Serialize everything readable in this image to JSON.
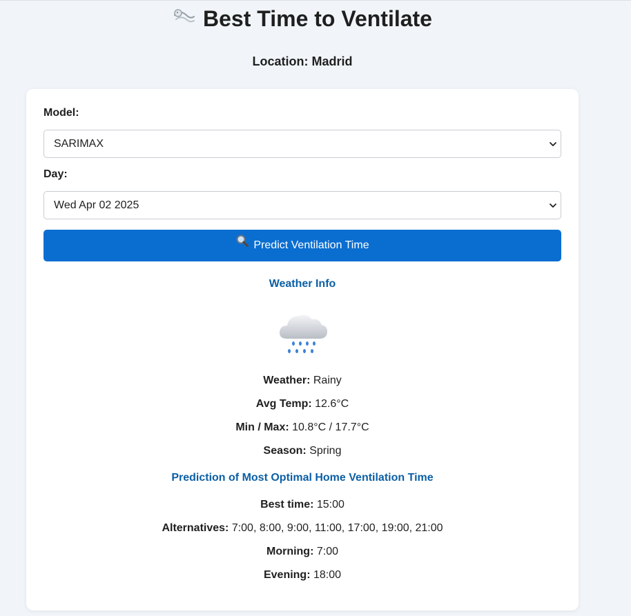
{
  "header": {
    "title": "Best Time to Ventilate",
    "location_label": "Location:",
    "location_value": "Madrid"
  },
  "form": {
    "model_label": "Model:",
    "model_value": "SARIMAX",
    "day_label": "Day:",
    "day_value": "Wed Apr 02 2025",
    "predict_button": "Predict Ventilation Time"
  },
  "weather": {
    "section_title": "Weather Info",
    "icon": "rain-cloud-icon",
    "weather_label": "Weather:",
    "weather_value": "Rainy",
    "avg_temp_label": "Avg Temp:",
    "avg_temp_value": "12.6°C",
    "minmax_label": "Min / Max:",
    "minmax_value": "10.8°C / 17.7°C",
    "season_label": "Season:",
    "season_value": "Spring"
  },
  "prediction": {
    "section_title": "Prediction of Most Optimal Home Ventilation Time",
    "best_label": "Best time:",
    "best_value": "15:00",
    "alternatives_label": "Alternatives:",
    "alternatives_value": "7:00, 8:00, 9:00, 11:00, 17:00, 19:00, 21:00",
    "morning_label": "Morning:",
    "morning_value": "7:00",
    "evening_label": "Evening:",
    "evening_value": "18:00"
  },
  "colors": {
    "accent": "#0a6ed1",
    "section_title": "#0b5fa5",
    "background": "#f1f5f9"
  }
}
